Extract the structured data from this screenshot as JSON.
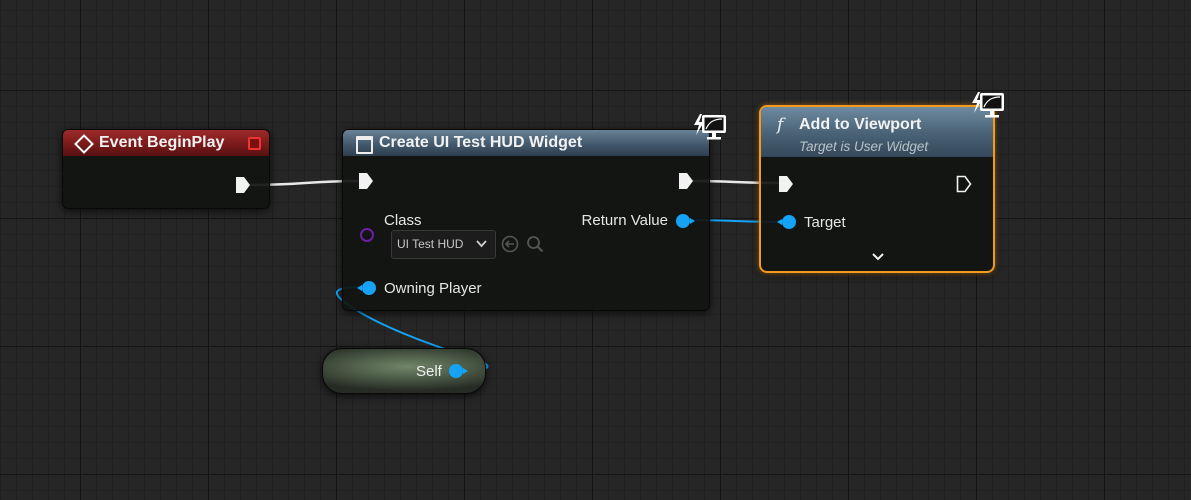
{
  "graph": {
    "colors": {
      "event_header": "#7a1a1a",
      "function_header": "#43596d",
      "object_pin": "#15a3f5",
      "class_pin": "#6c1fa8",
      "selection": "#f19a1e"
    },
    "nodes": {
      "event_begin_play": {
        "title": "Event BeginPlay",
        "icon": "event-diamond-icon"
      },
      "create_widget": {
        "title": "Create UI Test HUD Widget",
        "class_label": "Class",
        "class_value": "UI Test HUD",
        "return_label": "Return Value",
        "owning_player_label": "Owning Player"
      },
      "add_to_viewport": {
        "title": "Add to Viewport",
        "subtitle": "Target is User Widget",
        "function_icon": "f",
        "target_label": "Target"
      },
      "self": {
        "label": "Self"
      }
    }
  }
}
